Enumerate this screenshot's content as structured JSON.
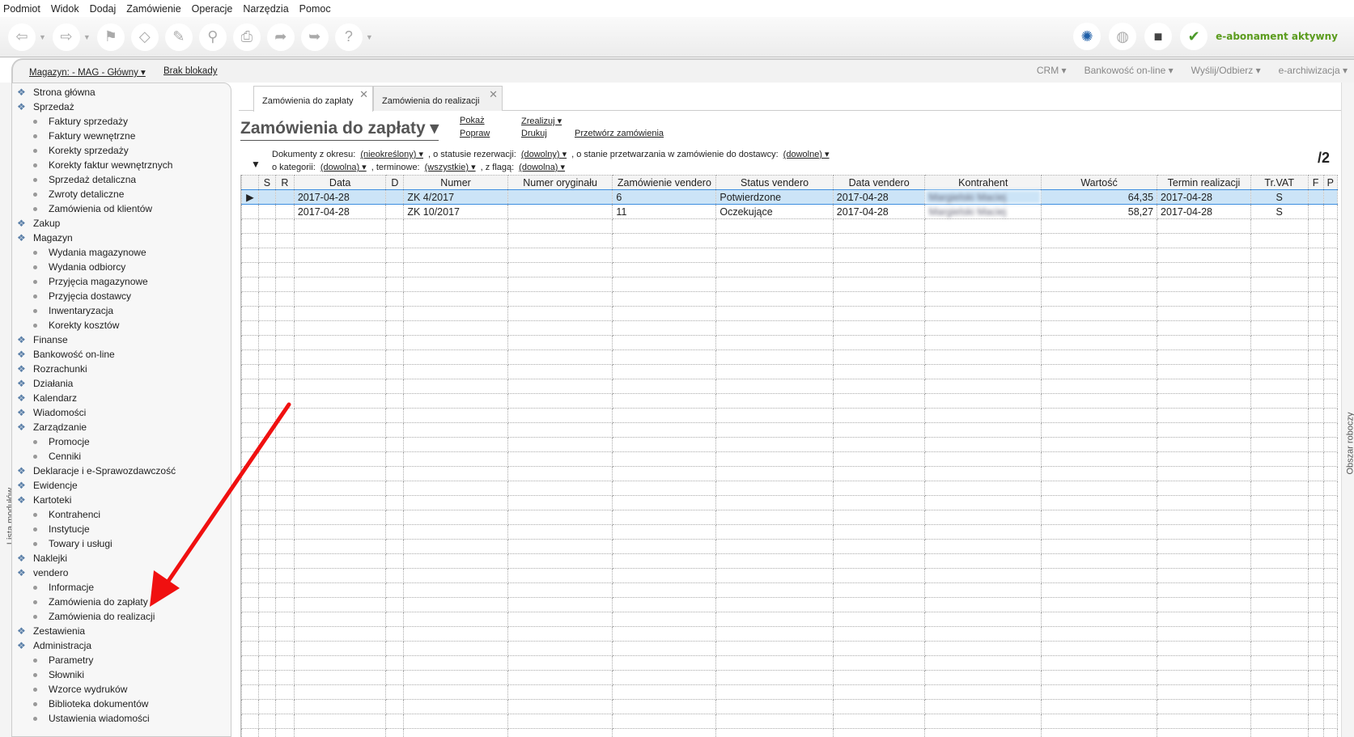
{
  "menu": [
    "Podmiot",
    "Widok",
    "Dodaj",
    "Zamówienie",
    "Operacje",
    "Narzędzia",
    "Pomoc"
  ],
  "toolbar": {
    "abonament": "e-abonament aktywny"
  },
  "bar2": {
    "magazyn": "Magazyn: - MAG - Główny ▾",
    "blokada": "Brak blokady",
    "crm": "CRM ▾",
    "bank": "Bankowość on-line ▾",
    "send": "Wyślij/Odbierz ▾",
    "arch": "e-archiwizacja ▾"
  },
  "side": {
    "left_label": "Lista modułów",
    "right_label": "Obszar roboczy"
  },
  "sidebar": [
    {
      "t": "top",
      "l": "Strona główna"
    },
    {
      "t": "top",
      "l": "Sprzedaż"
    },
    {
      "t": "sub",
      "l": "Faktury sprzedaży"
    },
    {
      "t": "sub",
      "l": "Faktury wewnętrzne"
    },
    {
      "t": "sub",
      "l": "Korekty sprzedaży"
    },
    {
      "t": "sub",
      "l": "Korekty faktur wewnętrznych"
    },
    {
      "t": "sub",
      "l": "Sprzedaż detaliczna"
    },
    {
      "t": "sub",
      "l": "Zwroty detaliczne"
    },
    {
      "t": "sub",
      "l": "Zamówienia od klientów"
    },
    {
      "t": "top",
      "l": "Zakup"
    },
    {
      "t": "top",
      "l": "Magazyn"
    },
    {
      "t": "sub",
      "l": "Wydania magazynowe"
    },
    {
      "t": "sub",
      "l": "Wydania odbiorcy"
    },
    {
      "t": "sub",
      "l": "Przyjęcia magazynowe"
    },
    {
      "t": "sub",
      "l": "Przyjęcia dostawcy"
    },
    {
      "t": "sub",
      "l": "Inwentaryzacja"
    },
    {
      "t": "sub",
      "l": "Korekty kosztów"
    },
    {
      "t": "top",
      "l": "Finanse"
    },
    {
      "t": "top",
      "l": "Bankowość on-line"
    },
    {
      "t": "top",
      "l": "Rozrachunki"
    },
    {
      "t": "top",
      "l": "Działania"
    },
    {
      "t": "top",
      "l": "Kalendarz"
    },
    {
      "t": "top",
      "l": "Wiadomości"
    },
    {
      "t": "top",
      "l": "Zarządzanie"
    },
    {
      "t": "sub",
      "l": "Promocje"
    },
    {
      "t": "sub",
      "l": "Cenniki"
    },
    {
      "t": "top",
      "l": "Deklaracje i e-Sprawozdawczość"
    },
    {
      "t": "top",
      "l": "Ewidencje"
    },
    {
      "t": "top",
      "l": "Kartoteki"
    },
    {
      "t": "sub",
      "l": "Kontrahenci"
    },
    {
      "t": "sub",
      "l": "Instytucje"
    },
    {
      "t": "sub",
      "l": "Towary i usługi"
    },
    {
      "t": "top",
      "l": "Naklejki"
    },
    {
      "t": "top",
      "l": "vendero"
    },
    {
      "t": "sub",
      "l": "Informacje"
    },
    {
      "t": "sub",
      "l": "Zamówienia do zapłaty"
    },
    {
      "t": "sub",
      "l": "Zamówienia do realizacji"
    },
    {
      "t": "top",
      "l": "Zestawienia"
    },
    {
      "t": "top",
      "l": "Administracja"
    },
    {
      "t": "sub",
      "l": "Parametry"
    },
    {
      "t": "sub",
      "l": "Słowniki"
    },
    {
      "t": "sub",
      "l": "Wzorce wydruków"
    },
    {
      "t": "sub",
      "l": "Biblioteka dokumentów"
    },
    {
      "t": "sub",
      "l": "Ustawienia wiadomości"
    }
  ],
  "tabs": [
    "Zamówienia do zapłaty",
    "Zamówienia do realizacji"
  ],
  "title": "Zamówienia do zapłaty ▾",
  "actions": {
    "pokaz": "Pokaż",
    "popraw": "Popraw",
    "zrealizuj": "Zrealizuj ▾",
    "drukuj": "Drukuj",
    "przetworz": "Przetwórz zamówienia"
  },
  "filters": {
    "l1a": "Dokumenty z okresu:",
    "v1a": "(nieokreślony) ▾",
    "l1b": ", o statusie rezerwacji:",
    "v1b": "(dowolny) ▾",
    "l1c": ", o stanie przetwarzania w zamówienie do dostawcy:",
    "v1c": "(dowolne) ▾",
    "l2a": "o kategorii:",
    "v2a": "(dowolna) ▾",
    "l2b": ", terminowe:",
    "v2b": "(wszystkie) ▾",
    "l2c": ", z flagą:",
    "v2c": "(dowolna) ▾"
  },
  "page": "/2",
  "columns": [
    "",
    "S",
    "R",
    "Data",
    "D",
    "Numer",
    "Numer oryginału",
    "Zamówienie vendero",
    "Status vendero",
    "Data vendero",
    "Kontrahent",
    "Wartość",
    "Termin realizacji",
    "Tr.VAT",
    "F",
    "P"
  ],
  "rows": [
    [
      "▶",
      "",
      "",
      "2017-04-28",
      "",
      "ZK 4/2017",
      "",
      "6",
      "Potwierdzone",
      "2017-04-28",
      "Margielski Maciej",
      "64,35",
      "2017-04-28",
      "S",
      "",
      ""
    ],
    [
      "",
      "",
      "",
      "2017-04-28",
      "",
      "ZK 10/2017",
      "",
      "11",
      "Oczekujące",
      "2017-04-28",
      "Margielski Maciej",
      "58,27",
      "2017-04-28",
      "S",
      "",
      ""
    ]
  ]
}
